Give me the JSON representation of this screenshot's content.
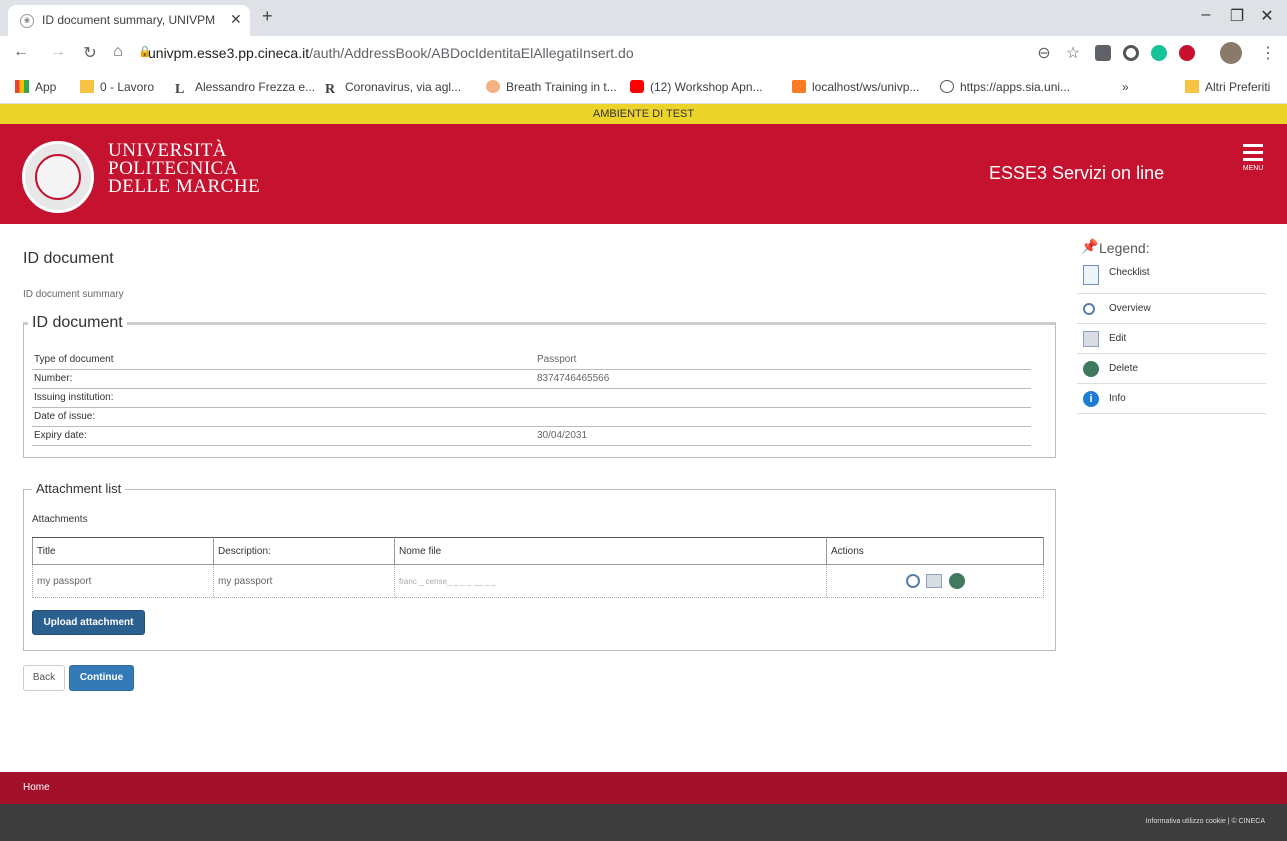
{
  "browser": {
    "tab_title": "ID document summary, UNIVPM",
    "url_host": "univpm.esse3.pp.cineca.it",
    "url_path": "/auth/AddressBook/ABDocIdentitaElAllegatiInsert.do",
    "bookmarks": [
      "App",
      "0 - Lavoro",
      "Alessandro Frezza e...",
      "Coronavirus, via agl...",
      "Breath Training in t...",
      "(12) Workshop Apn...",
      "localhost/ws/univp...",
      "https://apps.sia.uni..."
    ],
    "other_bookmarks": "Altri Preferiti",
    "overflow": "»"
  },
  "test_banner": "AMBIENTE DI TEST",
  "header": {
    "uni_line1": "UNIVERSITÀ",
    "uni_line2": "POLITECNICA",
    "uni_line3": "DELLE MARCHE",
    "service": "ESSE3 Servizi on line",
    "menu_label": "MENU"
  },
  "page": {
    "title": "ID document",
    "subtitle": "ID document summary"
  },
  "id_document": {
    "legend": "ID document",
    "rows": [
      {
        "label": "Type of document",
        "value": "Passport"
      },
      {
        "label": "Number:",
        "value": "8374746465566"
      },
      {
        "label": "Issuing institution:",
        "value": ""
      },
      {
        "label": "Date of issue:",
        "value": ""
      },
      {
        "label": "Expiry date:",
        "value": "30/04/2031"
      }
    ]
  },
  "attachments": {
    "legend": "Attachment list",
    "caption": "Attachments",
    "headers": [
      "Title",
      "Description:",
      "Nome file",
      "Actions"
    ],
    "rows": [
      {
        "title": "my passport",
        "description": "my passport",
        "filename": "franc   _  cense_ _  _ _ __ _ _"
      }
    ],
    "upload_label": "Upload attachment"
  },
  "actions": {
    "back_label": "Back",
    "continue_label": "Continue"
  },
  "legend_panel": {
    "title": "Legend:",
    "items": [
      "Checklist",
      "Overview",
      "Edit",
      "Delete",
      "Info"
    ]
  },
  "footer": {
    "home": "Home",
    "right": "Informativa utilizzo cookie | © CINECA"
  }
}
